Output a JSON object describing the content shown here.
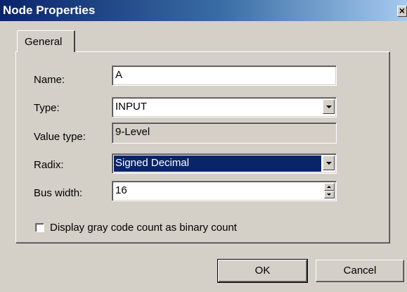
{
  "window": {
    "title": "Node Properties",
    "close_glyph": "×"
  },
  "tabs": [
    {
      "label": "General",
      "selected": true
    }
  ],
  "fields": {
    "name": {
      "label": "Name:",
      "value": "A"
    },
    "type": {
      "label": "Type:",
      "value": "INPUT"
    },
    "value_type": {
      "label": "Value type:",
      "value": "9-Level"
    },
    "radix": {
      "label": "Radix:",
      "value": "Signed Decimal"
    },
    "bus_width": {
      "label": "Bus width:",
      "value": "16"
    }
  },
  "options": {
    "gray_code": {
      "label": "Display gray code count as binary count",
      "checked": false
    }
  },
  "buttons": {
    "ok": "OK",
    "cancel": "Cancel"
  },
  "colors": {
    "dialog_face": "#d4d0c8",
    "titlebar_start": "#0a246a",
    "titlebar_end": "#a6caf0",
    "selection": "#0a246a"
  }
}
